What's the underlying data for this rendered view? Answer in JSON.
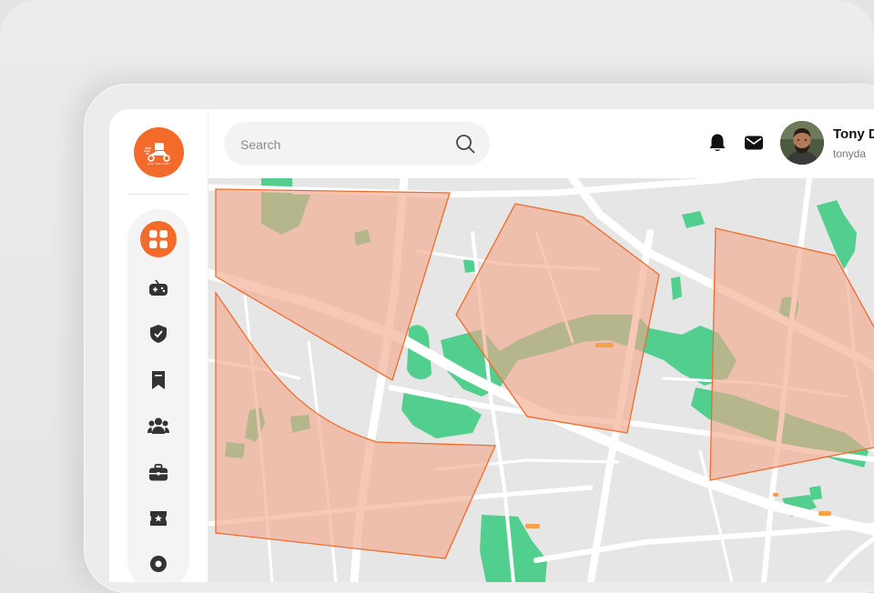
{
  "header": {
    "search": {
      "placeholder": "Search",
      "value": ""
    },
    "user": {
      "name": "Tony D",
      "email": "tonyda"
    }
  },
  "sidebar": {
    "logo": {
      "text": "FAST DELIVERY",
      "color": "#f26b2a"
    },
    "items": [
      {
        "icon": "dashboard-grid-icon",
        "active": true
      },
      {
        "icon": "gamepad-icon",
        "active": false
      },
      {
        "icon": "shield-check-icon",
        "active": false
      },
      {
        "icon": "bookmark-icon",
        "active": false
      },
      {
        "icon": "users-group-icon",
        "active": false
      },
      {
        "icon": "briefcase-icon",
        "active": false
      },
      {
        "icon": "ticket-star-icon",
        "active": false
      },
      {
        "icon": "circle-icon",
        "active": false
      }
    ]
  },
  "map": {
    "zone_fill": "#f4a78b",
    "zone_stroke": "#f26b2a",
    "park_color": "#52cf8f",
    "road_color": "#ffffff",
    "base_color": "#e6e6e6"
  },
  "colors": {
    "accent": "#f26b2a"
  }
}
